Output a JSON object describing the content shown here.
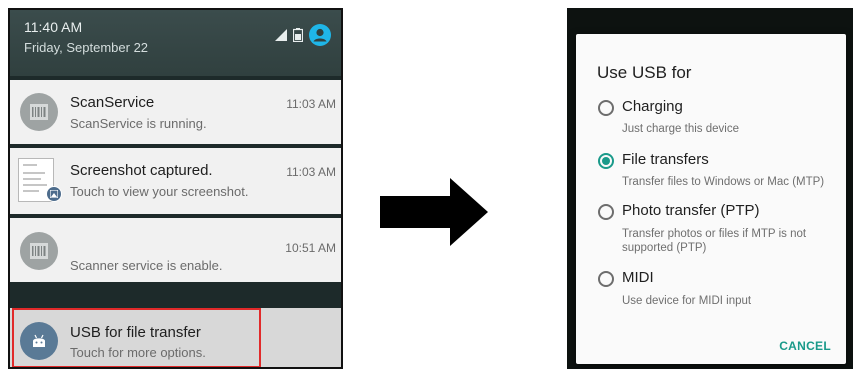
{
  "status_bar": {
    "time": "11:40 AM",
    "date": "Friday, September 22",
    "icons": [
      "signal-icon",
      "battery-icon",
      "account-icon"
    ]
  },
  "notifications": [
    {
      "title": "ScanService",
      "text": "ScanService is running.",
      "time": "11:03 AM",
      "icon": "barcode-icon"
    },
    {
      "title": "Screenshot captured.",
      "text": "Touch to view your screenshot.",
      "time": "11:03 AM",
      "icon": "screenshot-thumbnail"
    },
    {
      "title": "",
      "text": "Scanner service is enable.",
      "time": "10:51 AM",
      "icon": "barcode-icon"
    },
    {
      "title": "USB for file transfer",
      "text": "Touch for more options.",
      "time": "",
      "icon": "android-icon",
      "highlighted": true
    }
  ],
  "dialog": {
    "title": "Use USB for",
    "options": [
      {
        "label": "Charging",
        "description": "Just charge this device",
        "selected": false
      },
      {
        "label": "File transfers",
        "description": "Transfer files to Windows or Mac (MTP)",
        "selected": true
      },
      {
        "label": "Photo transfer (PTP)",
        "description": "Transfer photos or files if MTP is not supported (PTP)",
        "selected": false
      },
      {
        "label": "MIDI",
        "description": "Use device for MIDI input",
        "selected": false
      }
    ],
    "cancel_label": "CANCEL"
  },
  "colors": {
    "accent": "#1a9a8a",
    "highlight_border": "#e12a2a",
    "status_bar": "#34454a"
  }
}
